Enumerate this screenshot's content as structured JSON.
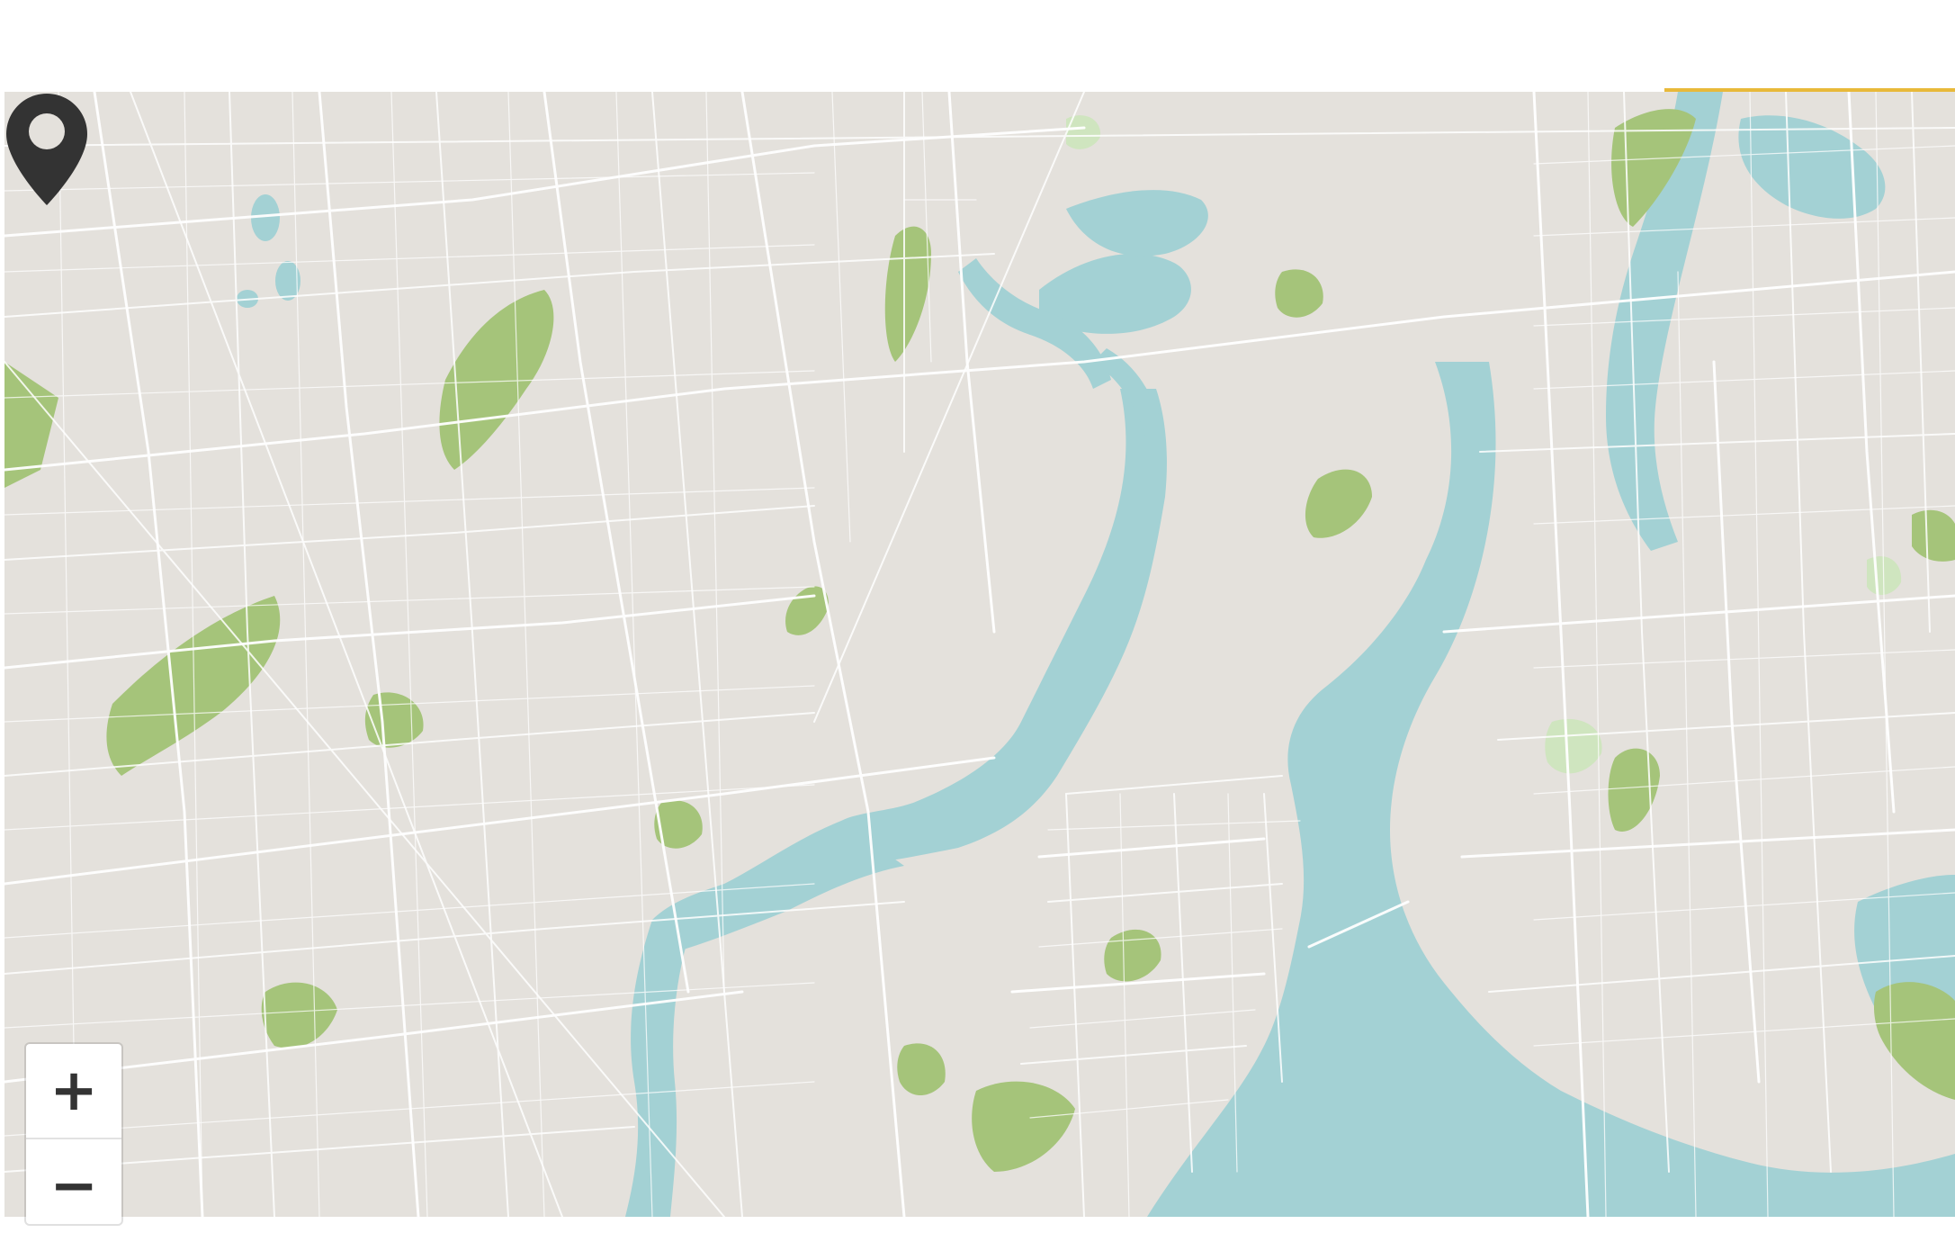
{
  "colors": {
    "land": "#e4e1dc",
    "water": "#a3d1d4",
    "park": "#a5c47a",
    "park_light": "#cfe5bf",
    "road": "#ffffff",
    "pin": "#333333",
    "accent": "#e8b93a"
  },
  "map": {
    "marker_icon": "map-pin-icon",
    "controls": {
      "zoom_in_label": "+",
      "zoom_out_label": "−"
    }
  }
}
